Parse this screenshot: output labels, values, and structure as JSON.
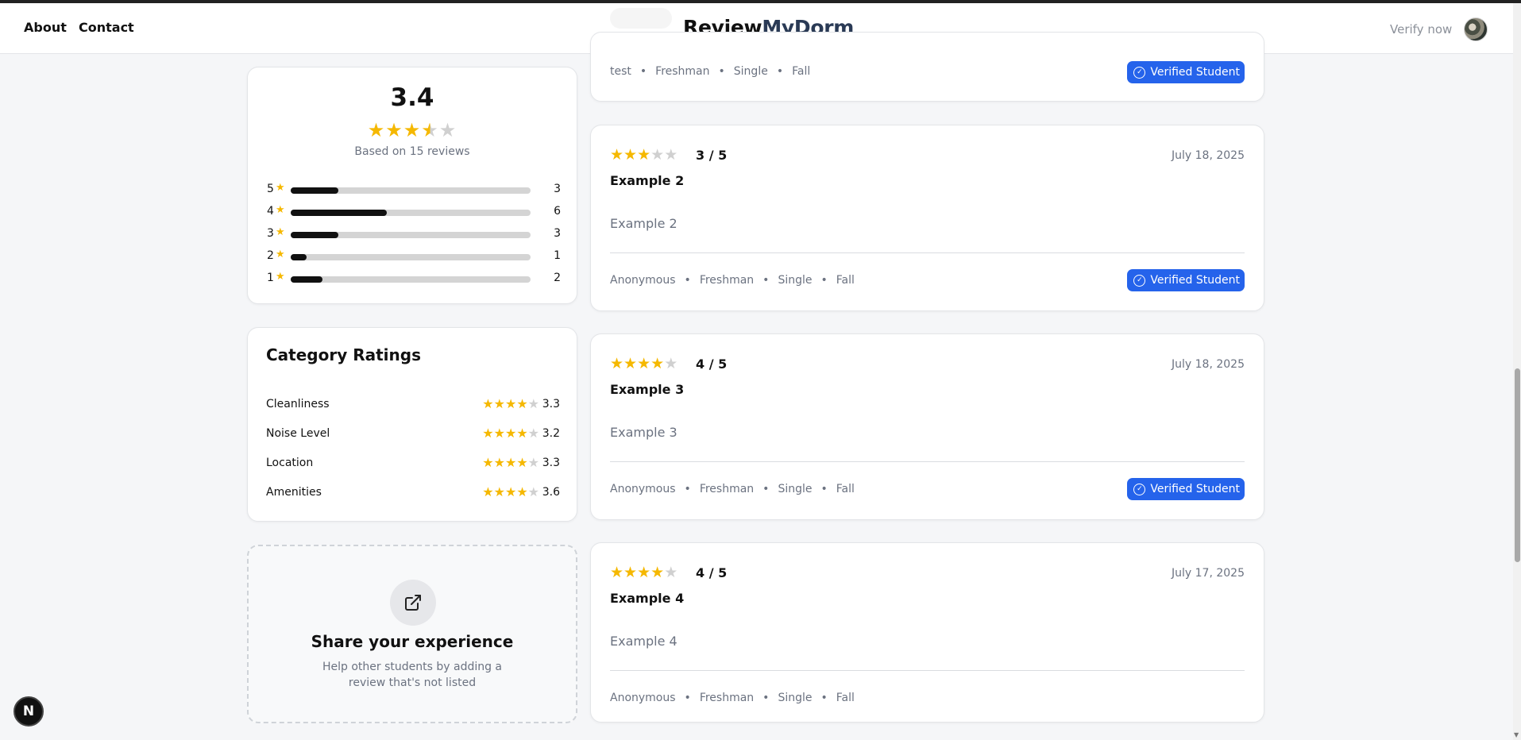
{
  "header": {
    "nav": [
      "About",
      "Contact"
    ],
    "logo_part1": "Review",
    "logo_part2": "MyDorm",
    "verify_label": "Verify now"
  },
  "colors": {
    "star": "#f5b800",
    "badge": "#2563eb",
    "bar_fill": "#111111",
    "bar_track": "#d4d4d4"
  },
  "summary": {
    "average": "3.4",
    "average_value": 3.4,
    "based_on": "Based on 15 reviews",
    "distribution": [
      {
        "stars": "5",
        "count": "3",
        "value": 3
      },
      {
        "stars": "4",
        "count": "6",
        "value": 6
      },
      {
        "stars": "3",
        "count": "3",
        "value": 3
      },
      {
        "stars": "2",
        "count": "1",
        "value": 1
      },
      {
        "stars": "1",
        "count": "2",
        "value": 2
      }
    ]
  },
  "categories": {
    "title": "Category Ratings",
    "items": [
      {
        "label": "Cleanliness",
        "value": "3.3",
        "stars": 4
      },
      {
        "label": "Noise Level",
        "value": "3.2",
        "stars": 4
      },
      {
        "label": "Location",
        "value": "3.3",
        "stars": 4
      },
      {
        "label": "Amenities",
        "value": "3.6",
        "stars": 4
      }
    ]
  },
  "share": {
    "title": "Share your experience",
    "description": "Help other students by adding a review that's not listed",
    "icon": "external-link-icon"
  },
  "reviews": [
    {
      "partial": true,
      "meta": [
        "test",
        "Freshman",
        "Single",
        "Fall"
      ],
      "badge": "Verified Student"
    },
    {
      "rating": 3,
      "score": "3 / 5",
      "date": "July 18, 2025",
      "title": "Example 2",
      "body": "Example 2",
      "meta": [
        "Anonymous",
        "Freshman",
        "Single",
        "Fall"
      ],
      "badge": "Verified Student"
    },
    {
      "rating": 4,
      "score": "4 / 5",
      "date": "July 18, 2025",
      "title": "Example 3",
      "body": "Example 3",
      "meta": [
        "Anonymous",
        "Freshman",
        "Single",
        "Fall"
      ],
      "badge": "Verified Student"
    },
    {
      "rating": 4,
      "score": "4 / 5",
      "date": "July 17, 2025",
      "title": "Example 4",
      "body": "Example 4",
      "meta": [
        "Anonymous",
        "Freshman",
        "Single",
        "Fall"
      ],
      "badge": ""
    }
  ],
  "dev_badge": "N"
}
